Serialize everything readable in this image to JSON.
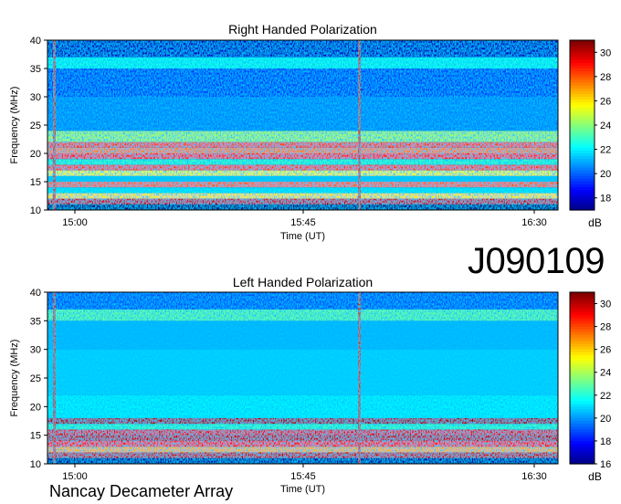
{
  "observation_id": "J090109",
  "footer_label": "Nancay Decameter Array",
  "colormap": [
    "#00007f",
    "#0000ff",
    "#0080ff",
    "#00ffff",
    "#80ff80",
    "#ffff00",
    "#ff8000",
    "#ff0000",
    "#7f0000"
  ],
  "chart_data": [
    {
      "type": "heatmap",
      "title": "Right Handed Polarization",
      "xlabel": "Time (UT)",
      "ylabel": "Frequency (MHz)",
      "x_ticks": [
        "15:00",
        "15:45",
        "16:30"
      ],
      "y_ticks": [
        10,
        15,
        20,
        25,
        30,
        35,
        40
      ],
      "ylim": [
        10,
        40
      ],
      "colorbar": {
        "label": "dB",
        "ticks": [
          18,
          20,
          22,
          24,
          26,
          28,
          30
        ],
        "range": [
          17,
          31
        ]
      },
      "background_db": 19.0,
      "frequency_bands_db": [
        {
          "mhz": [
            10,
            11
          ],
          "db": 17.0
        },
        {
          "mhz": [
            11,
            12
          ],
          "db": 30.0
        },
        {
          "mhz": [
            12,
            13
          ],
          "db": 26.0
        },
        {
          "mhz": [
            13,
            14
          ],
          "db": 22.0
        },
        {
          "mhz": [
            14,
            15
          ],
          "db": 28.0
        },
        {
          "mhz": [
            15,
            16
          ],
          "db": 21.5
        },
        {
          "mhz": [
            16,
            17
          ],
          "db": 25.5
        },
        {
          "mhz": [
            17,
            18
          ],
          "db": 28.5
        },
        {
          "mhz": [
            18,
            19
          ],
          "db": 23.0
        },
        {
          "mhz": [
            19,
            20
          ],
          "db": 29.0
        },
        {
          "mhz": [
            20,
            21
          ],
          "db": 27.5
        },
        {
          "mhz": [
            21,
            22
          ],
          "db": 28.5
        },
        {
          "mhz": [
            22,
            24
          ],
          "db": 24.5
        },
        {
          "mhz": [
            24,
            30
          ],
          "db": 20.5
        },
        {
          "mhz": [
            30,
            35
          ],
          "db": 19.5
        },
        {
          "mhz": [
            35,
            37
          ],
          "db": 22.5
        },
        {
          "mhz": [
            37,
            40
          ],
          "db": 18.0
        }
      ]
    },
    {
      "type": "heatmap",
      "title": "Left Handed Polarization",
      "xlabel": "Time (UT)",
      "ylabel": "Frequency (MHz)",
      "x_ticks": [
        "15:00",
        "15:45",
        "16:30"
      ],
      "y_ticks": [
        10,
        15,
        20,
        25,
        30,
        35,
        40
      ],
      "ylim": [
        10,
        40
      ],
      "colorbar": {
        "label": "dB",
        "ticks": [
          16,
          18,
          20,
          22,
          24,
          26,
          28,
          30
        ],
        "range": [
          16,
          31
        ]
      },
      "background_db": 19.5,
      "frequency_bands_db": [
        {
          "mhz": [
            10,
            11
          ],
          "db": 16.5
        },
        {
          "mhz": [
            11,
            12
          ],
          "db": 30.0
        },
        {
          "mhz": [
            12,
            13
          ],
          "db": 26.5
        },
        {
          "mhz": [
            13,
            14
          ],
          "db": 29.0
        },
        {
          "mhz": [
            14,
            15
          ],
          "db": 30.0
        },
        {
          "mhz": [
            15,
            16
          ],
          "db": 29.5
        },
        {
          "mhz": [
            16,
            17
          ],
          "db": 22.5
        },
        {
          "mhz": [
            17,
            18
          ],
          "db": 30.5
        },
        {
          "mhz": [
            18,
            22
          ],
          "db": 21.5
        },
        {
          "mhz": [
            22,
            30
          ],
          "db": 21.0
        },
        {
          "mhz": [
            30,
            35
          ],
          "db": 20.5
        },
        {
          "mhz": [
            35,
            37
          ],
          "db": 23.0
        },
        {
          "mhz": [
            37,
            40
          ],
          "db": 19.0
        }
      ]
    }
  ]
}
